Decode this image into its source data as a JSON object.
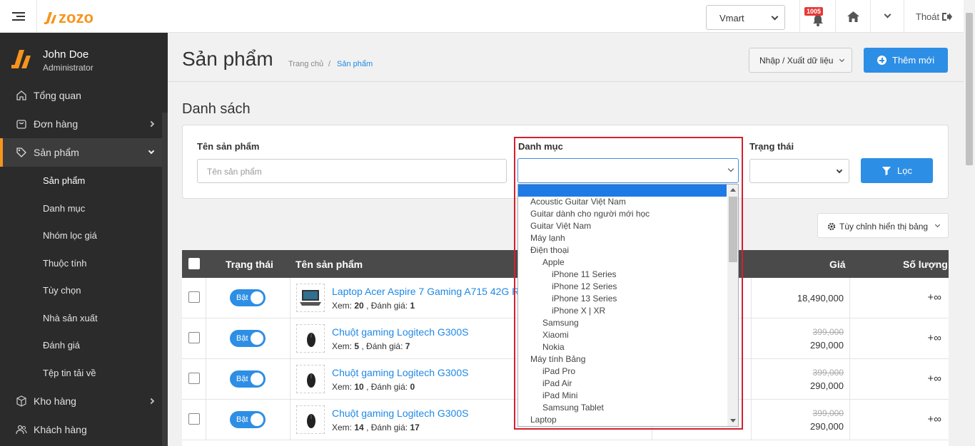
{
  "header": {
    "logo_text": "zozo",
    "store_select": "Vmart",
    "notification_count": "1005",
    "logout_label": "Thoát"
  },
  "user": {
    "name": "John Doe",
    "role": "Administrator"
  },
  "sidebar": {
    "items": [
      {
        "label": "Tổng quan",
        "icon": "home-outline-icon"
      },
      {
        "label": "Đơn hàng",
        "icon": "cart-icon"
      },
      {
        "label": "Sản phẩm",
        "icon": "tag-icon"
      },
      {
        "label": "Kho hàng",
        "icon": "box-icon"
      },
      {
        "label": "Khách hàng",
        "icon": "users-icon"
      }
    ],
    "sub_items": [
      "Sản phẩm",
      "Danh mục",
      "Nhóm lọc giá",
      "Thuộc tính",
      "Tùy chọn",
      "Nhà sản xuất",
      "Đánh giá",
      "Tệp tin tải về"
    ]
  },
  "page": {
    "title": "Sản phẩm",
    "breadcrumb_home": "Trang chủ",
    "breadcrumb_sep": "/",
    "breadcrumb_current": "Sản phẩm",
    "import_export_label": "Nhập / Xuất dữ liệu",
    "add_new_label": "Thêm mới",
    "section_title": "Danh sách"
  },
  "filter": {
    "name_label": "Tên sản phẩm",
    "name_placeholder": "Tên sản phẩm",
    "category_label": "Danh mục",
    "status_label": "Trạng thái",
    "filter_button": "Lọc",
    "customize_label": "Tùy chỉnh hiển thị bảng"
  },
  "table": {
    "headers": {
      "status": "Trạng thái",
      "name": "Tên sản phẩm",
      "price": "Giá",
      "qty": "Số lượng"
    },
    "view_label": "Xem:",
    "rating_label": ", Đánh giá:",
    "rows": [
      {
        "status": "Bật",
        "name": "Laptop Acer Aspire 7 Gaming A715 42G R",
        "views": "20",
        "rating": "1",
        "old_price": "",
        "price": "18,490,000",
        "qty": "+∞"
      },
      {
        "status": "Bật",
        "name": "Chuột gaming Logitech G300S",
        "views": "5",
        "rating": "7",
        "old_price": "399,000",
        "price": "290,000",
        "qty": "+∞"
      },
      {
        "status": "Bật",
        "name": "Chuột gaming Logitech G300S",
        "views": "10",
        "rating": "0",
        "old_price": "399,000",
        "price": "290,000",
        "qty": "+∞"
      },
      {
        "status": "Bật",
        "name": "Chuột gaming Logitech G300S",
        "views": "14",
        "rating": "17",
        "old_price": "399,000",
        "price": "290,000",
        "qty": "+∞"
      }
    ]
  },
  "category_dropdown": {
    "options": [
      {
        "label": "Acoustic Guitar Việt Nam",
        "level": 0
      },
      {
        "label": "Guitar dành cho người mới học",
        "level": 0
      },
      {
        "label": "Guitar Việt Nam",
        "level": 0
      },
      {
        "label": "Máy lạnh",
        "level": 0
      },
      {
        "label": "Điện thoại",
        "level": 0
      },
      {
        "label": "Apple",
        "level": 1
      },
      {
        "label": "iPhone 11 Series",
        "level": 2
      },
      {
        "label": "iPhone 12 Series",
        "level": 2
      },
      {
        "label": "iPhone 13 Series",
        "level": 2
      },
      {
        "label": "iPhone X | XR",
        "level": 2
      },
      {
        "label": "Samsung",
        "level": 1
      },
      {
        "label": "Xiaomi",
        "level": 1
      },
      {
        "label": "Nokia",
        "level": 1
      },
      {
        "label": "Máy tính Bảng",
        "level": 0
      },
      {
        "label": "iPad Pro",
        "level": 1
      },
      {
        "label": "iPad Air",
        "level": 1
      },
      {
        "label": "iPad Mini",
        "level": 1
      },
      {
        "label": "Samsung Tablet",
        "level": 1
      },
      {
        "label": "Laptop",
        "level": 0
      }
    ]
  },
  "colors": {
    "accent": "#f7941d",
    "primary": "#2d8ee5",
    "highlight": "#d3212f"
  }
}
